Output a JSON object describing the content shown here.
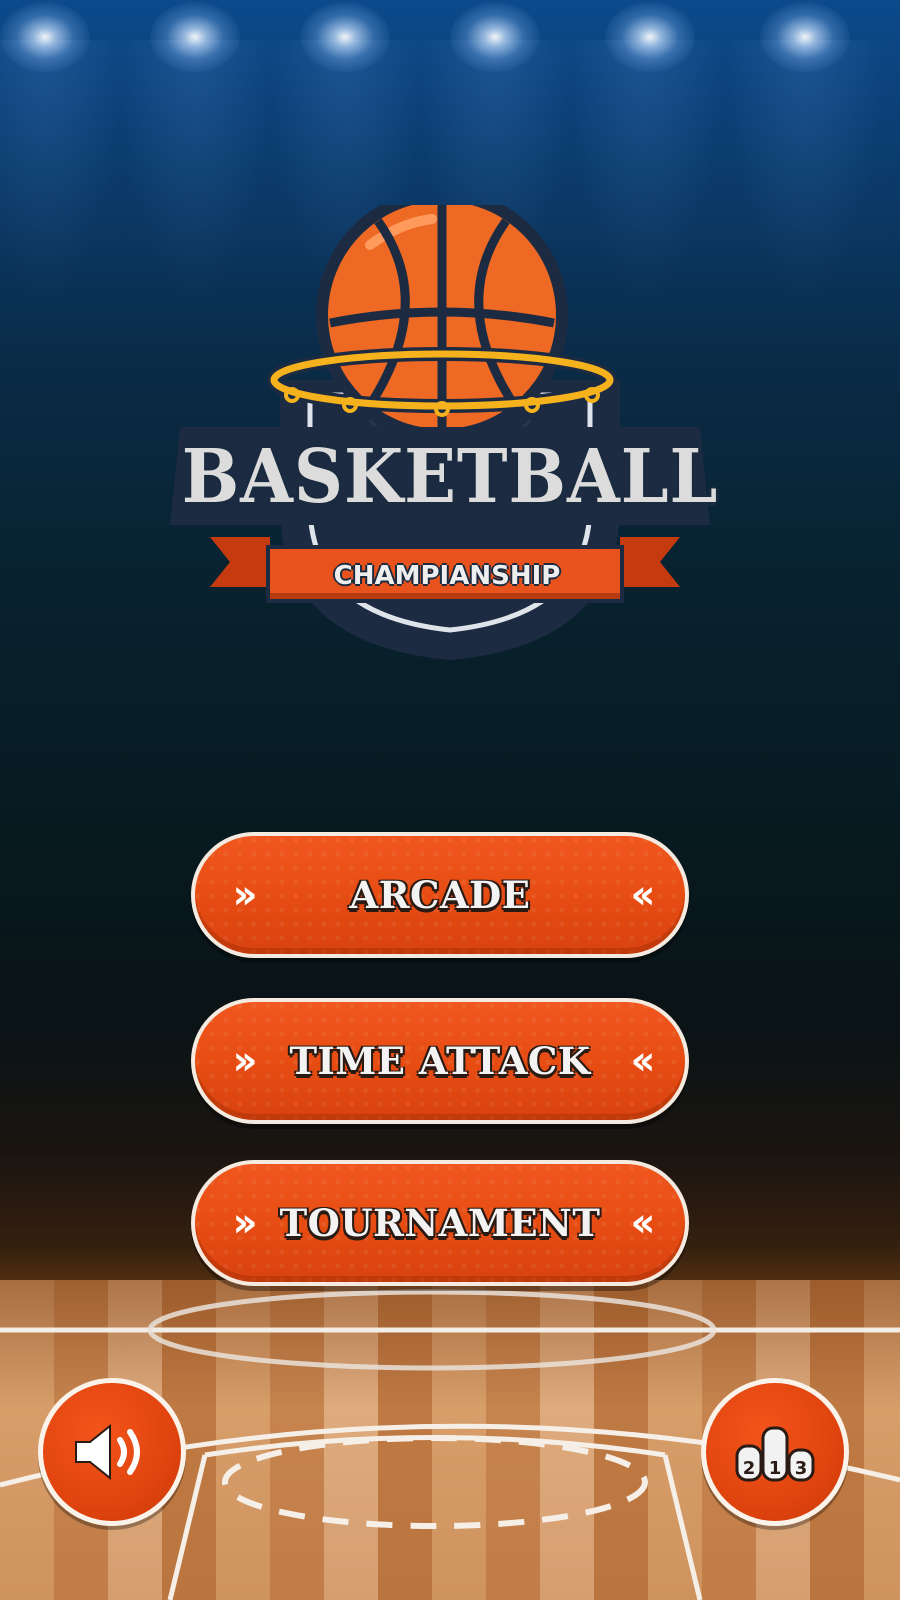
{
  "logo": {
    "title": "BASKETBALL",
    "subtitle": "CHAMPIANSHIP"
  },
  "menu": {
    "buttons": [
      {
        "label": "ARCADE"
      },
      {
        "label": "TIME ATTACK"
      },
      {
        "label": "TOURNAMENT"
      }
    ],
    "chevron_left": "››",
    "chevron_right": "‹‹"
  },
  "bottom_bar": {
    "sound_icon": "speaker-icon",
    "leaderboard_icon": "podium-icon",
    "podium_digits": [
      "2",
      "1",
      "3"
    ]
  },
  "colors": {
    "button_orange": "#e64c12",
    "button_border": "#f4eadf",
    "logo_navy": "#1a2a3f",
    "ribbon_orange": "#e8521c"
  }
}
